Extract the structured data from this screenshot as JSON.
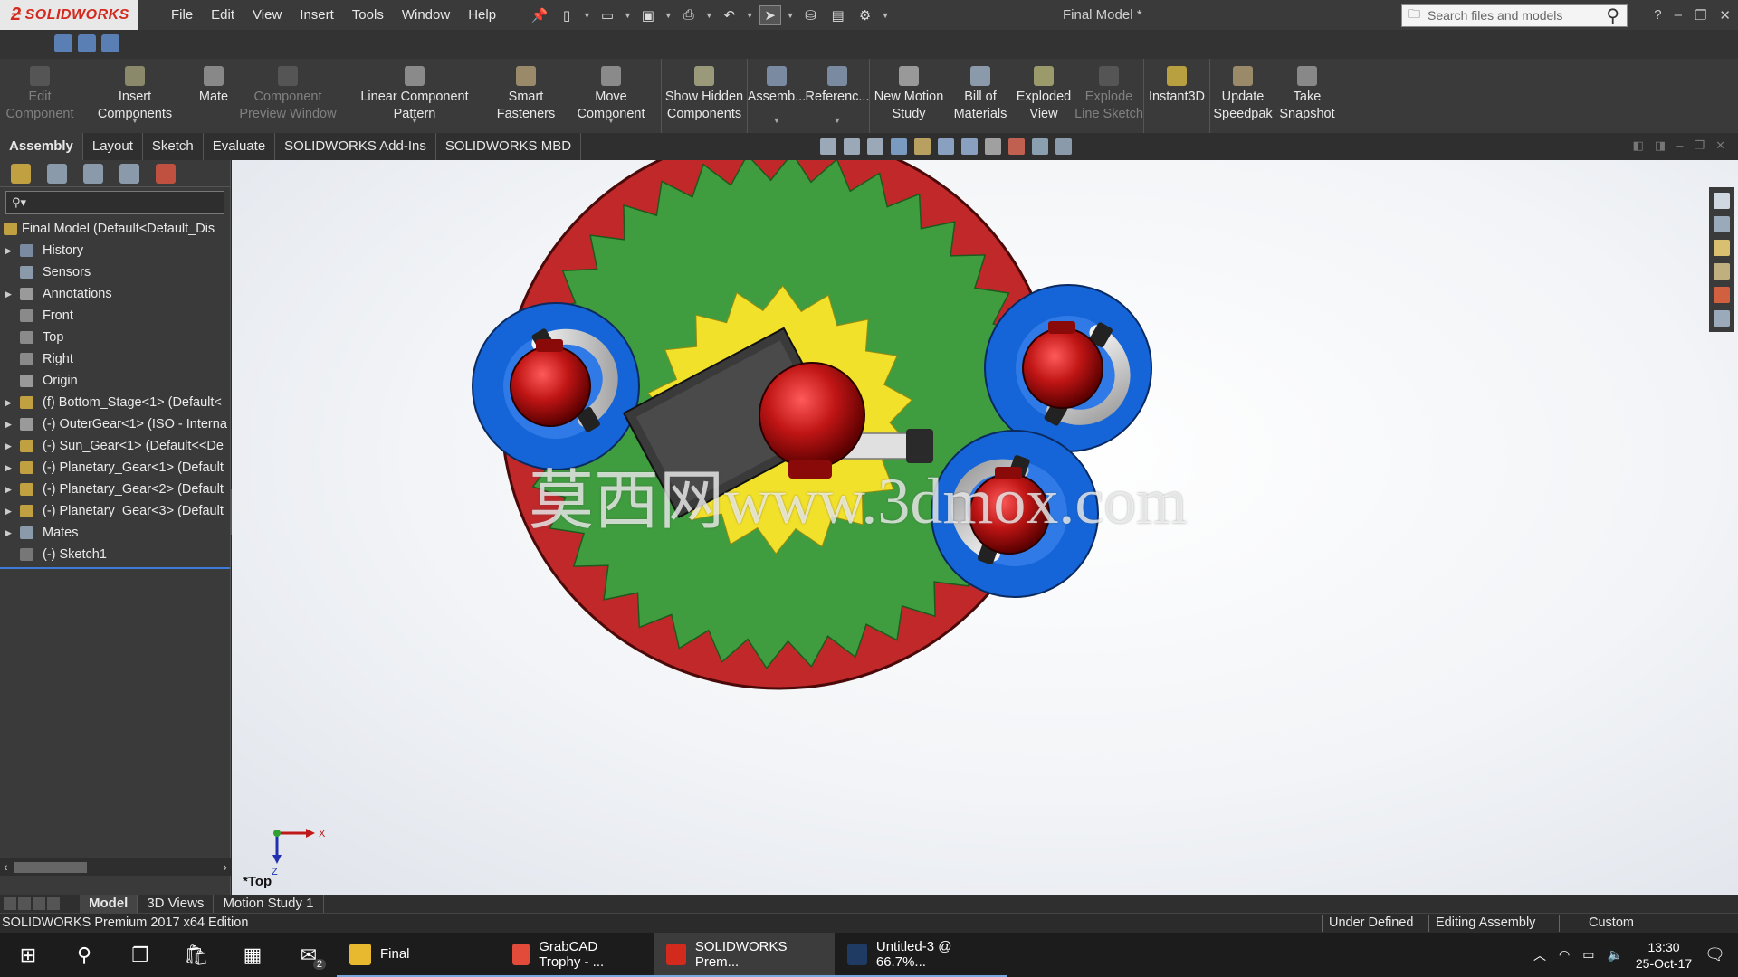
{
  "titlebar": {
    "logo": "SOLIDWORKS",
    "menus": [
      "File",
      "Edit",
      "View",
      "Insert",
      "Tools",
      "Window",
      "Help"
    ],
    "doc_title": "Final Model *",
    "search_placeholder": "Search files and models"
  },
  "toolbar": [
    {
      "label1": "Edit",
      "label2": "Component",
      "disabled": true
    },
    {
      "label1": "Insert Components",
      "label2": "",
      "disabled": false
    },
    {
      "label1": "Mate",
      "label2": "",
      "disabled": false
    },
    {
      "label1": "Component",
      "label2": "Preview Window",
      "disabled": true
    },
    {
      "label1": "Linear Component Pattern",
      "label2": "",
      "disabled": false
    },
    {
      "label1": "Smart",
      "label2": "Fasteners",
      "disabled": false
    },
    {
      "label1": "Move Component",
      "label2": "",
      "disabled": false
    },
    {
      "label1": "Show Hidden",
      "label2": "Components",
      "disabled": false
    },
    {
      "label1": "Assemb...",
      "label2": "",
      "disabled": false
    },
    {
      "label1": "Referenc...",
      "label2": "",
      "disabled": false
    },
    {
      "label1": "New Motion",
      "label2": "Study",
      "disabled": false
    },
    {
      "label1": "Bill of",
      "label2": "Materials",
      "disabled": false
    },
    {
      "label1": "Exploded",
      "label2": "View",
      "disabled": false
    },
    {
      "label1": "Explode",
      "label2": "Line Sketch",
      "disabled": true
    },
    {
      "label1": "Instant3D",
      "label2": "",
      "disabled": false
    },
    {
      "label1": "Update",
      "label2": "Speedpak",
      "disabled": false
    },
    {
      "label1": "Take",
      "label2": "Snapshot",
      "disabled": false
    }
  ],
  "tabs": [
    "Assembly",
    "Layout",
    "Sketch",
    "Evaluate",
    "SOLIDWORKS Add-Ins",
    "SOLIDWORKS MBD"
  ],
  "tree": {
    "root": "Final Model  (Default<Default_Dis",
    "items": [
      {
        "label": "History",
        "expandable": true
      },
      {
        "label": "Sensors",
        "expandable": false
      },
      {
        "label": "Annotations",
        "expandable": true
      },
      {
        "label": "Front",
        "expandable": false
      },
      {
        "label": "Top",
        "expandable": false
      },
      {
        "label": "Right",
        "expandable": false
      },
      {
        "label": "Origin",
        "expandable": false
      },
      {
        "label": "(f) Bottom_Stage<1> (Default<",
        "expandable": true
      },
      {
        "label": "(-) OuterGear<1> (ISO - Interna",
        "expandable": true
      },
      {
        "label": "(-) Sun_Gear<1> (Default<<De",
        "expandable": true
      },
      {
        "label": "(-) Planetary_Gear<1> (Default",
        "expandable": true
      },
      {
        "label": "(-) Planetary_Gear<2> (Default",
        "expandable": true
      },
      {
        "label": "(-) Planetary_Gear<3> (Default",
        "expandable": true
      },
      {
        "label": "Mates",
        "expandable": true
      },
      {
        "label": "(-) Sketch1",
        "expandable": false
      }
    ]
  },
  "viewport": {
    "watermark": "莫西网www.3dmox.com",
    "view_label": "*Top",
    "axis_x": "X",
    "axis_z": "Z"
  },
  "bottom_tabs": [
    "Model",
    "3D Views",
    "Motion Study 1"
  ],
  "status": {
    "edition": "SOLIDWORKS Premium 2017 x64 Edition",
    "defined": "Under Defined",
    "mode": "Editing Assembly",
    "units": "Custom"
  },
  "taskbar": {
    "apps": [
      {
        "label": "Final",
        "color": "#e8b92e"
      },
      {
        "label": "GrabCAD Trophy - ...",
        "color": "#e24b3a"
      },
      {
        "label": "SOLIDWORKS Prem...",
        "color": "#d32a1e"
      },
      {
        "label": "Untitled-3 @ 66.7%...",
        "color": "#1f3b63"
      }
    ],
    "mail_badge": "2",
    "time": "13:30",
    "date": "25-Oct-17"
  },
  "colors": {
    "ring_red": "#c0282a",
    "gear_green": "#3f9d3f",
    "sun_yellow": "#f2e12a",
    "planet_blue": "#1565d8",
    "motor_red": "#b81414"
  }
}
